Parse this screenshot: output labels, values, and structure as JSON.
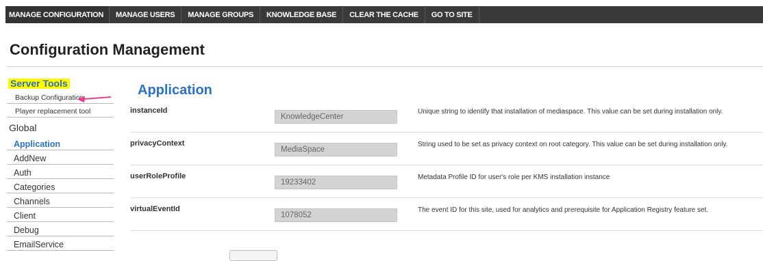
{
  "topnav": {
    "items": [
      {
        "label": "MANAGE CONFIGURATION"
      },
      {
        "label": "MANAGE USERS"
      },
      {
        "label": "MANAGE GROUPS"
      },
      {
        "label": "KNOWLEDGE BASE"
      },
      {
        "label": "CLEAR THE CACHE"
      },
      {
        "label": "GO TO SITE"
      }
    ],
    "bg_color": "#3a3a3a"
  },
  "page_title": "Configuration Management",
  "sidebar": {
    "server_tools_heading": "Server Tools",
    "highlight_color": "#fff700",
    "tools": [
      {
        "label": "Backup Configuration"
      },
      {
        "label": "Player replacement tool"
      }
    ],
    "annotation_arrow": "pink-arrow-icon",
    "arrow_color": "#e83f8b",
    "global_heading": "Global",
    "items": [
      {
        "label": "Application",
        "active": true
      },
      {
        "label": "AddNew"
      },
      {
        "label": "Auth"
      },
      {
        "label": "Categories"
      },
      {
        "label": "Channels"
      },
      {
        "label": "Client"
      },
      {
        "label": "Debug"
      },
      {
        "label": "EmailService"
      }
    ]
  },
  "main": {
    "section_title": "Application",
    "accent_color": "#2a72c9",
    "fields": [
      {
        "name": "instanceId",
        "value": "KnowledgeCenter",
        "description": "Unique string to identify that installation of mediaspace. This value can be set during installation only."
      },
      {
        "name": "privacyContext",
        "value": "MediaSpace",
        "description": "String used to be set as privacy context on root category. This value can be set during installation only."
      },
      {
        "name": "userRoleProfile",
        "value": "19233402",
        "description": "Metadata Profile ID for user's role per KMS installation instance"
      },
      {
        "name": "virtualEventId",
        "value": "1078052",
        "description": "The event ID for this site, used for analytics and prerequisite for Application Registry feature set."
      }
    ]
  }
}
